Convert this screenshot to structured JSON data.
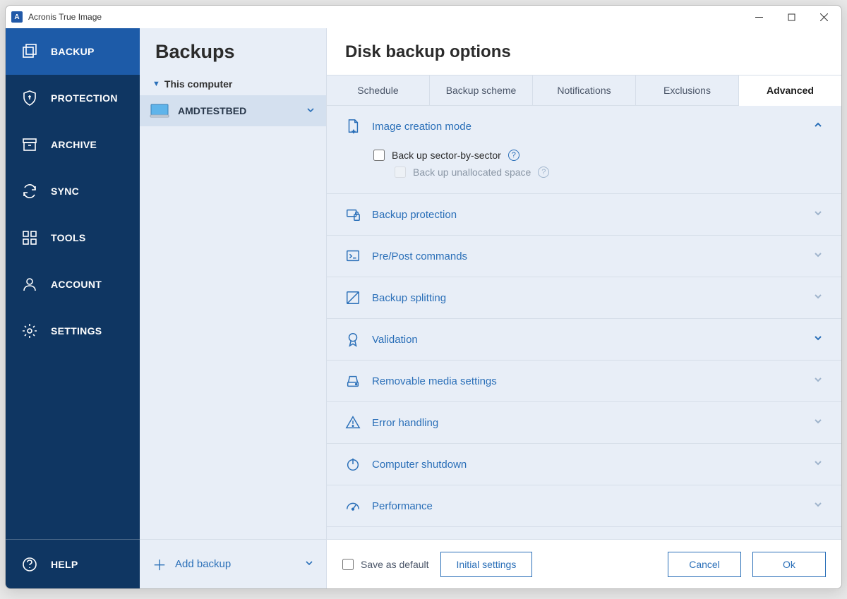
{
  "app": {
    "title": "Acronis True Image"
  },
  "sidebar": {
    "items": [
      {
        "label": "BACKUP"
      },
      {
        "label": "PROTECTION"
      },
      {
        "label": "ARCHIVE"
      },
      {
        "label": "SYNC"
      },
      {
        "label": "TOOLS"
      },
      {
        "label": "ACCOUNT"
      },
      {
        "label": "SETTINGS"
      }
    ],
    "help": "HELP"
  },
  "mid": {
    "title": "Backups",
    "group": "This computer",
    "item": "AMDTESTBED",
    "add": "Add backup"
  },
  "main": {
    "title": "Disk backup options",
    "tabs": [
      {
        "label": "Schedule"
      },
      {
        "label": "Backup scheme"
      },
      {
        "label": "Notifications"
      },
      {
        "label": "Exclusions"
      },
      {
        "label": "Advanced"
      }
    ],
    "sections": [
      {
        "label": "Image creation mode"
      },
      {
        "label": "Backup protection"
      },
      {
        "label": "Pre/Post commands"
      },
      {
        "label": "Backup splitting"
      },
      {
        "label": "Validation"
      },
      {
        "label": "Removable media settings"
      },
      {
        "label": "Error handling"
      },
      {
        "label": "Computer shutdown"
      },
      {
        "label": "Performance"
      }
    ],
    "image_mode": {
      "sector": "Back up sector-by-sector",
      "unalloc": "Back up unallocated space"
    }
  },
  "footer": {
    "save_default": "Save as default",
    "initial": "Initial settings",
    "cancel": "Cancel",
    "ok": "Ok"
  }
}
